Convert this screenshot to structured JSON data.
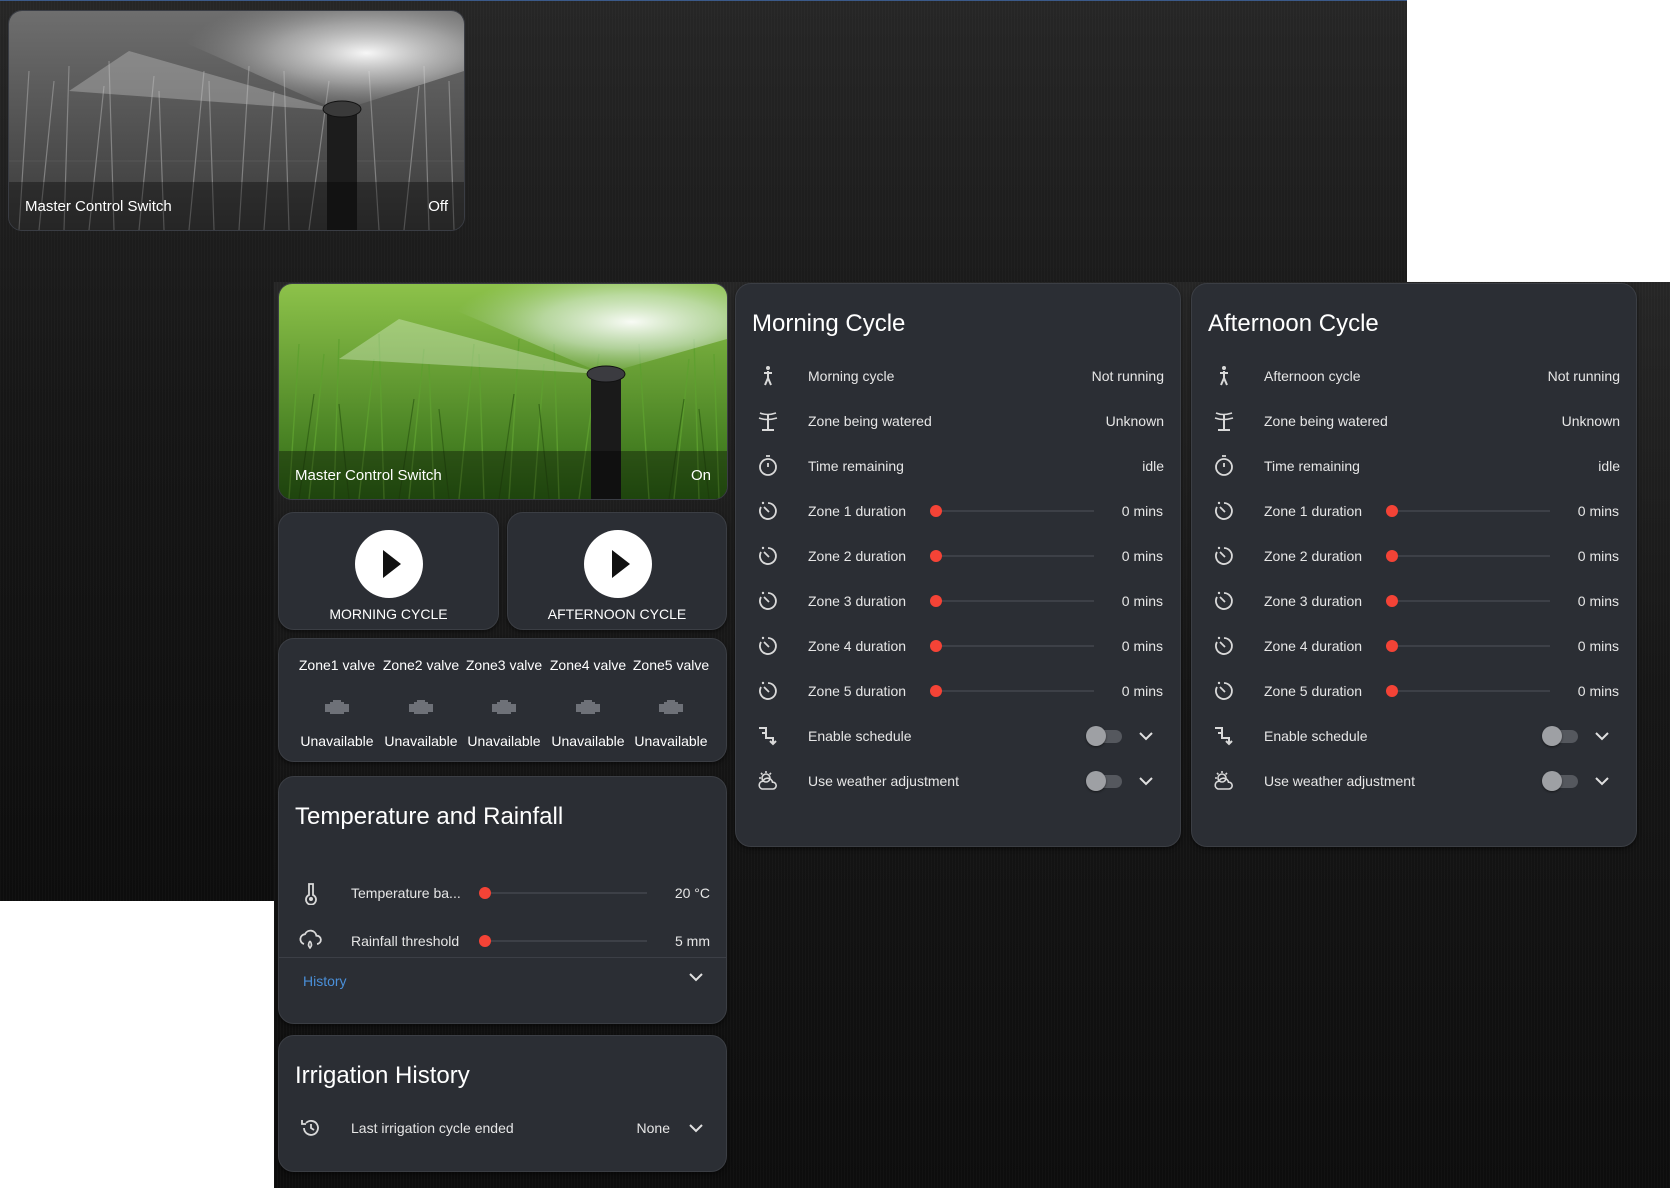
{
  "master_top": {
    "label": "Master Control Switch",
    "state": "Off"
  },
  "master_main": {
    "label": "Master Control Switch",
    "state": "On"
  },
  "cycle_buttons": [
    {
      "label": "MORNING CYCLE"
    },
    {
      "label": "AFTERNOON CYCLE"
    }
  ],
  "zones": [
    {
      "name": "Zone1 valve",
      "status": "Unavailable"
    },
    {
      "name": "Zone2 valve",
      "status": "Unavailable"
    },
    {
      "name": "Zone3 valve",
      "status": "Unavailable"
    },
    {
      "name": "Zone4 valve",
      "status": "Unavailable"
    },
    {
      "name": "Zone5 valve",
      "status": "Unavailable"
    }
  ],
  "temperature": {
    "title": "Temperature and Rainfall",
    "rows": [
      {
        "label": "Temperature ba...",
        "value": "20 °C",
        "icon": "thermometer-icon"
      },
      {
        "label": "Rainfall threshold",
        "value": "5 mm",
        "icon": "weather-rainy-icon"
      }
    ],
    "history_label": "History"
  },
  "irrigation_history": {
    "title": "Irrigation History",
    "row": {
      "label": "Last irrigation cycle ended",
      "value": "None",
      "icon": "history-icon"
    }
  },
  "morning": {
    "title": "Morning Cycle",
    "status_rows": [
      {
        "label": "Morning cycle",
        "value": "Not running",
        "icon": "person-walking-icon"
      },
      {
        "label": "Zone being watered",
        "value": "Unknown",
        "icon": "sprinkler-icon"
      },
      {
        "label": "Time remaining",
        "value": "idle",
        "icon": "timer-icon"
      }
    ],
    "durations": [
      {
        "label": "Zone 1 duration",
        "value": "0 mins"
      },
      {
        "label": "Zone 2 duration",
        "value": "0 mins"
      },
      {
        "label": "Zone 3 duration",
        "value": "0 mins"
      },
      {
        "label": "Zone 4 duration",
        "value": "0 mins"
      },
      {
        "label": "Zone 5 duration",
        "value": "0 mins"
      }
    ],
    "toggles": [
      {
        "label": "Enable schedule",
        "icon": "calendar-clock-icon",
        "on": false
      },
      {
        "label": "Use weather adjustment",
        "icon": "weather-partly-cloudy-icon",
        "on": false
      }
    ]
  },
  "afternoon": {
    "title": "Afternoon Cycle",
    "status_rows": [
      {
        "label": "Afternoon cycle",
        "value": "Not running",
        "icon": "person-walking-icon"
      },
      {
        "label": "Zone being watered",
        "value": "Unknown",
        "icon": "sprinkler-icon"
      },
      {
        "label": "Time remaining",
        "value": "idle",
        "icon": "timer-icon"
      }
    ],
    "durations": [
      {
        "label": "Zone 1 duration",
        "value": "0 mins"
      },
      {
        "label": "Zone 2 duration",
        "value": "0 mins"
      },
      {
        "label": "Zone 3 duration",
        "value": "0 mins"
      },
      {
        "label": "Zone 4 duration",
        "value": "0 mins"
      },
      {
        "label": "Zone 5 duration",
        "value": "0 mins"
      }
    ],
    "toggles": [
      {
        "label": "Enable schedule",
        "icon": "calendar-clock-icon",
        "on": false
      },
      {
        "label": "Use weather adjustment",
        "icon": "weather-partly-cloudy-icon",
        "on": false
      }
    ]
  },
  "colors": {
    "slider_thumb": "#f44336",
    "card_bg": "#2b2e34",
    "link": "#4a8fd8"
  }
}
